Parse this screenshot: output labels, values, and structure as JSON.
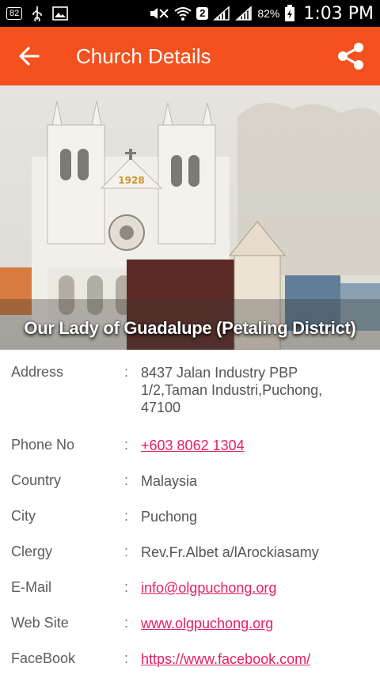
{
  "status_bar": {
    "notif_badge": "82",
    "network_badge": "2",
    "battery": "82%",
    "time": "1:03 PM"
  },
  "app_bar": {
    "title": "Church Details",
    "back_icon": "arrow-left-icon",
    "share_icon": "share-icon"
  },
  "hero": {
    "church_name": "Our Lady of Guadalupe (Petaling District)",
    "facade_year": "1928"
  },
  "details": [
    {
      "key": "address",
      "label": "Address",
      "value": "8437 Jalan Industry PBP 1/2,Taman Industri,Puchong, 47100",
      "link": false
    },
    {
      "key": "phone",
      "label": "Phone No",
      "value": "+603 8062 1304",
      "link": true
    },
    {
      "key": "country",
      "label": "Country",
      "value": "Malaysia",
      "link": false
    },
    {
      "key": "city",
      "label": "City",
      "value": "Puchong",
      "link": false
    },
    {
      "key": "clergy",
      "label": "Clergy",
      "value": "Rev.Fr.Albet a/lArockiasamy",
      "link": false
    },
    {
      "key": "email",
      "label": "E-Mail",
      "value": "info@olgpuchong.org",
      "link": true
    },
    {
      "key": "website",
      "label": "Web Site",
      "value": "www.olgpuchong.org",
      "link": true
    },
    {
      "key": "facebook",
      "label": "FaceBook",
      "value": "https://www.facebook.com/",
      "link": true
    }
  ],
  "separator": ":",
  "colors": {
    "app_bar": "#f4511e",
    "link": "#e91e63",
    "label_text": "#5c5c5c"
  }
}
